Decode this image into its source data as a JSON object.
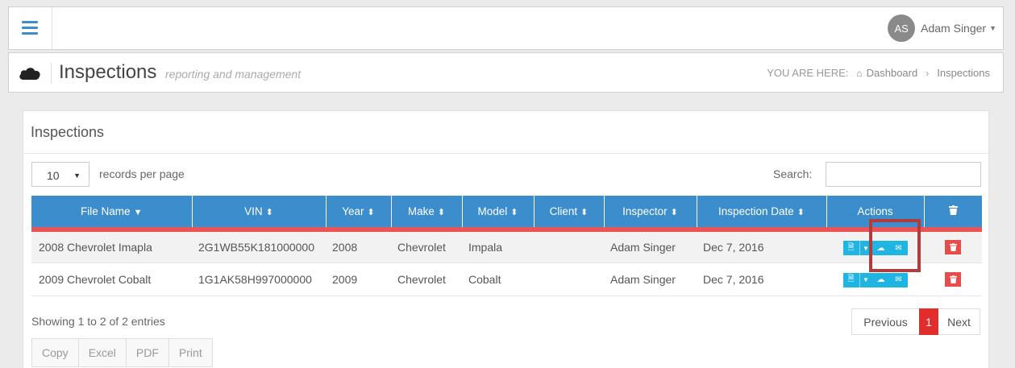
{
  "user": {
    "initials": "AS",
    "name": "Adam Singer"
  },
  "page": {
    "title": "Inspections",
    "subtitle": "reporting and management"
  },
  "breadcrumb": {
    "prefix": "YOU ARE HERE:",
    "home": "Dashboard",
    "current": "Inspections"
  },
  "panel": {
    "title": "Inspections"
  },
  "controls": {
    "page_length": "10",
    "page_length_label": "records per page",
    "search_label": "Search:",
    "search_value": ""
  },
  "table": {
    "headers": [
      "File Name",
      "VIN",
      "Year",
      "Make",
      "Model",
      "Client",
      "Inspector",
      "Inspection Date",
      "Actions"
    ],
    "rows": [
      {
        "file_name": "2008 Chevrolet Imapla",
        "vin": "2G1WB55K181000000",
        "year": "2008",
        "make": "Chevrolet",
        "model": "Impala",
        "client": "",
        "inspector": "Adam Singer",
        "date": "Dec 7, 2016"
      },
      {
        "file_name": "2009 Chevrolet Cobalt",
        "vin": "1G1AK58H997000000",
        "year": "2009",
        "make": "Chevrolet",
        "model": "Cobalt",
        "client": "",
        "inspector": "Adam Singer",
        "date": "Dec 7, 2016"
      }
    ]
  },
  "footer": {
    "info": "Showing 1 to 2 of 2 entries",
    "pagination": {
      "previous": "Previous",
      "current": "1",
      "next": "Next"
    },
    "export_buttons": [
      "Copy",
      "Excel",
      "PDF",
      "Print"
    ]
  },
  "colors": {
    "header_blue": "#3c8dcc",
    "accent_red": "#e95557",
    "action_cyan": "#20b4e3",
    "delete_red": "#e74c4c"
  },
  "icons": [
    "hamburger-icon",
    "cloud-icon",
    "home-icon",
    "sort-icon",
    "trash-icon",
    "file-pdf-icon",
    "cloud-upload-icon",
    "envelope-icon"
  ]
}
